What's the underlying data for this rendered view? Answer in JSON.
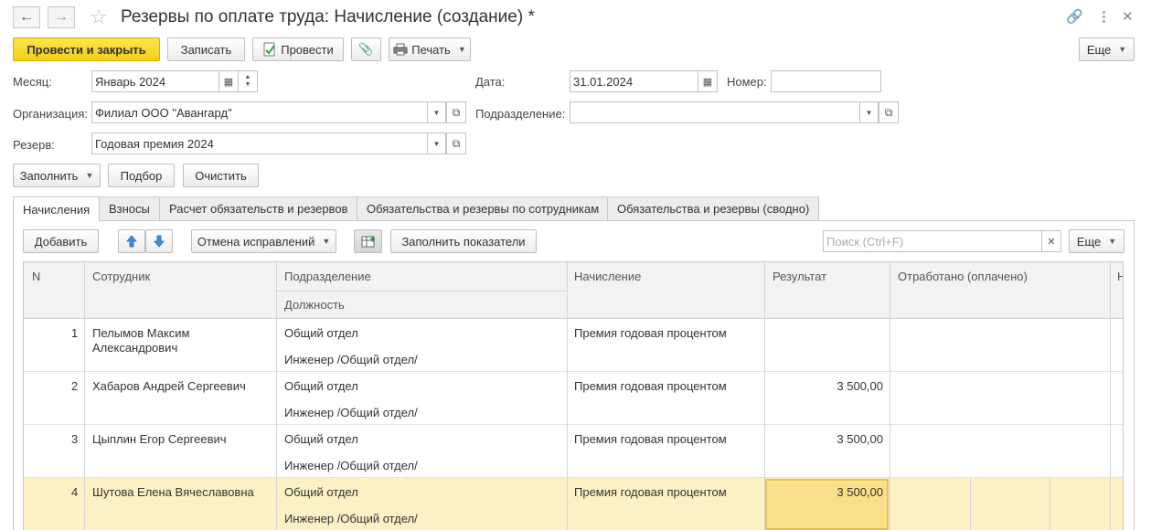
{
  "window": {
    "title": "Резервы по оплате труда: Начисление (создание) *"
  },
  "icons": {
    "back": "arrow-left-icon",
    "forward": "arrow-right-icon",
    "favorite": "star-icon",
    "link": "link-icon",
    "more": "vertical-dots-icon",
    "close": "close-icon"
  },
  "toolbar": {
    "post_close": "Провести и закрыть",
    "save": "Записать",
    "post": "Провести",
    "print": "Печать",
    "more": "Еще"
  },
  "form": {
    "month_label": "Месяц:",
    "month_value": "Январь 2024",
    "date_label": "Дата:",
    "date_value": "31.01.2024",
    "number_label": "Номер:",
    "number_value": "",
    "org_label": "Организация:",
    "org_value": "Филиал ООО \"Авангард\"",
    "dept_label": "Подразделение:",
    "dept_value": "",
    "reserve_label": "Резерв:",
    "reserve_value": "Годовая премия 2024"
  },
  "actions": {
    "fill": "Заполнить",
    "select": "Подбор",
    "clear": "Очистить"
  },
  "tabs": [
    {
      "label": "Начисления",
      "active": true
    },
    {
      "label": "Взносы"
    },
    {
      "label": "Расчет обязательств и резервов"
    },
    {
      "label": "Обязательства и резервы по сотрудникам"
    },
    {
      "label": "Обязательства и резервы (сводно)"
    }
  ],
  "table_toolbar": {
    "add": "Добавить",
    "cancel_corrections": "Отмена исправлений",
    "fill_indicators": "Заполнить показатели",
    "search_placeholder": "Поиск (Ctrl+F)",
    "more": "Еще"
  },
  "table": {
    "headers": {
      "n": "N",
      "employee": "Сотрудник",
      "department": "Подразделение",
      "position": "Должность",
      "accrual": "Начисление",
      "result": "Результат",
      "worked": "Отработано (оплачено)",
      "extra": "Н"
    },
    "rows": [
      {
        "n": "1",
        "employee": "Пелымов Максим",
        "employee2": "Александрович",
        "department": "Общий отдел",
        "position": "Инженер /Общий отдел/",
        "accrual": "Премия годовая процентом",
        "result": ""
      },
      {
        "n": "2",
        "employee": "Хабаров Андрей Сергеевич",
        "employee2": "",
        "department": "Общий отдел",
        "position": "Инженер /Общий отдел/",
        "accrual": "Премия годовая процентом",
        "result": "3 500,00"
      },
      {
        "n": "3",
        "employee": "Цыплин Егор Сергеевич",
        "employee2": "",
        "department": "Общий отдел",
        "position": "Инженер /Общий отдел/",
        "accrual": "Премия годовая процентом",
        "result": "3 500,00"
      },
      {
        "n": "4",
        "employee": "Шутова Елена Вячеславовна",
        "employee2": "",
        "department": "Общий отдел",
        "position": "Инженер /Общий отдел/",
        "accrual": "Премия годовая процентом",
        "result": "3 500,00"
      }
    ]
  },
  "colors": {
    "primary_button": "#f3cf0e",
    "selected_row": "#fbf1c4",
    "selected_cell": "#f8df8a",
    "arrow_blue": "#3a8fd8"
  }
}
